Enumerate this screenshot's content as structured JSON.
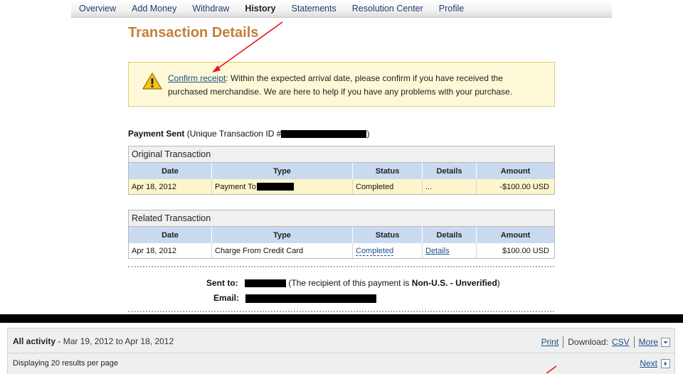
{
  "nav": {
    "items": [
      "Overview",
      "Add Money",
      "Withdraw",
      "History",
      "Statements",
      "Resolution Center",
      "Profile"
    ],
    "active": "History"
  },
  "page_title": "Transaction Details",
  "notice": {
    "link": "Confirm receipt",
    "text": ": Within the expected arrival date, please confirm if you have received the purchased merchandise. We are here to help if you have any problems with your purchase."
  },
  "payment": {
    "label": "Payment Sent",
    "prefix": "(Unique Transaction ID #",
    "suffix": ")"
  },
  "original": {
    "caption": "Original Transaction",
    "headers": [
      "Date",
      "Type",
      "Status",
      "Details",
      "Amount"
    ],
    "row": {
      "date": "Apr 18, 2012",
      "type": "Payment To",
      "status": "Completed",
      "details": "...",
      "amount": "-$100.00 USD"
    }
  },
  "related": {
    "caption": "Related Transaction",
    "headers": [
      "Date",
      "Type",
      "Status",
      "Details",
      "Amount"
    ],
    "row": {
      "date": "Apr 18, 2012",
      "type": "Charge From Credit Card",
      "status": "Completed",
      "details": "Details",
      "amount": "$100.00 USD"
    }
  },
  "sent_to": {
    "label": "Sent to:",
    "note_prefix": "(The recipient of this payment is ",
    "note_bold": "Non-U.S. - Unverified",
    "note_suffix": ")"
  },
  "email": {
    "label": "Email:"
  },
  "activity": {
    "title": "All activity",
    "range": " - Mar 19, 2012 to Apr 18, 2012",
    "print": "Print",
    "download_label": "Download:",
    "csv": "CSV",
    "more": "More",
    "display": "Displaying 20 results per page",
    "next": "Next"
  },
  "colors": {
    "title": "#c47f39",
    "link": "#1d4e89",
    "header_bg": "#c9daf0",
    "notice_bg": "#fdf9d8"
  }
}
